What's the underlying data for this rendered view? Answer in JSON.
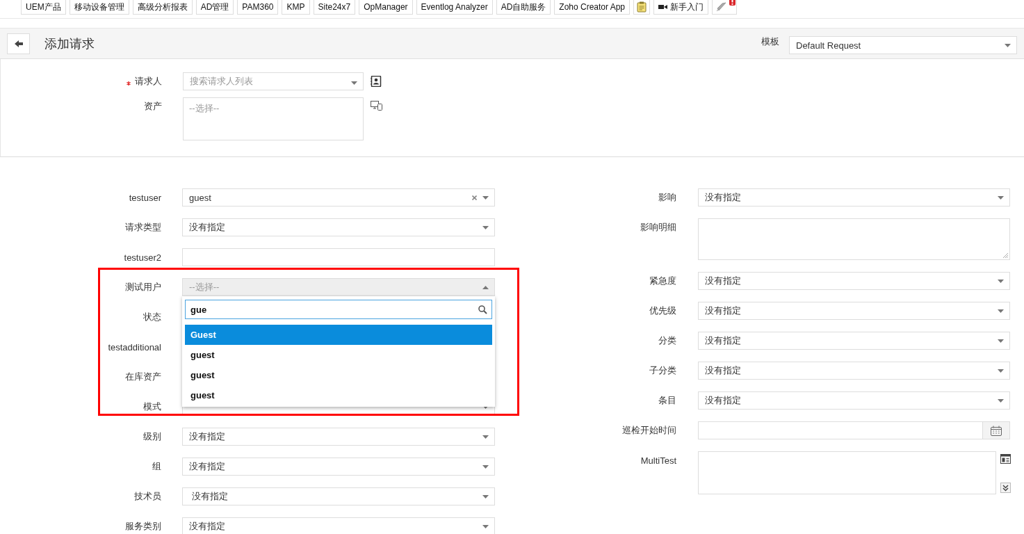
{
  "toolbar": {
    "links": [
      "UEM产品",
      "移动设备管理",
      "高级分析报表",
      "AD管理",
      "PAM360",
      "KMP",
      "Site24x7",
      "OpManager",
      "Eventlog Analyzer",
      "AD自助服务",
      "Zoho Creator App"
    ],
    "getting_started": "新手入门"
  },
  "header": {
    "title": "添加请求",
    "template_label": "模板",
    "template_value": "Default Request"
  },
  "requester": {
    "label": "请求人",
    "required": true,
    "placeholder": "搜索请求人列表"
  },
  "asset": {
    "label": "资产",
    "placeholder": "--选择--"
  },
  "left_fields": [
    {
      "label": "testuser",
      "kind": "select",
      "value": "guest",
      "clearable": true
    },
    {
      "label": "请求类型",
      "kind": "select",
      "value": "没有指定"
    },
    {
      "label": "testuser2",
      "kind": "text"
    },
    {
      "label": "测试用户",
      "kind": "select",
      "placeholder": "--选择--",
      "open": true,
      "dropdown": {
        "search": "gue",
        "options": [
          {
            "label": "Guest",
            "selected": true
          },
          {
            "label": "guest",
            "selected": false
          },
          {
            "label": "guest",
            "selected": false
          },
          {
            "label": "guest",
            "selected": false
          }
        ]
      }
    },
    {
      "label": "状态",
      "kind": "covered"
    },
    {
      "label": "testadditional",
      "kind": "covered"
    },
    {
      "label": "在库资产",
      "kind": "covered"
    },
    {
      "label": "模式",
      "kind": "select"
    },
    {
      "label": "级别",
      "kind": "select",
      "value": "没有指定"
    },
    {
      "label": "组",
      "kind": "select",
      "value": "没有指定"
    },
    {
      "label": "技术员",
      "kind": "select",
      "value": " 没有指定"
    },
    {
      "label": "服务类别",
      "kind": "select",
      "value": "没有指定"
    }
  ],
  "right_fields": [
    {
      "label": "影响",
      "kind": "select",
      "value": "没有指定"
    },
    {
      "label": "影响明细",
      "kind": "textarea"
    },
    {
      "label": "紧急度",
      "kind": "select",
      "value": "没有指定"
    },
    {
      "label": "优先级",
      "kind": "select",
      "value": "没有指定"
    },
    {
      "label": "分类",
      "kind": "select",
      "value": "没有指定"
    },
    {
      "label": "子分类",
      "kind": "select",
      "value": "没有指定"
    },
    {
      "label": "条目",
      "kind": "select",
      "value": "没有指定"
    },
    {
      "label": "巡检开始时间",
      "kind": "date"
    },
    {
      "label": "MultiTest",
      "kind": "multi"
    }
  ]
}
